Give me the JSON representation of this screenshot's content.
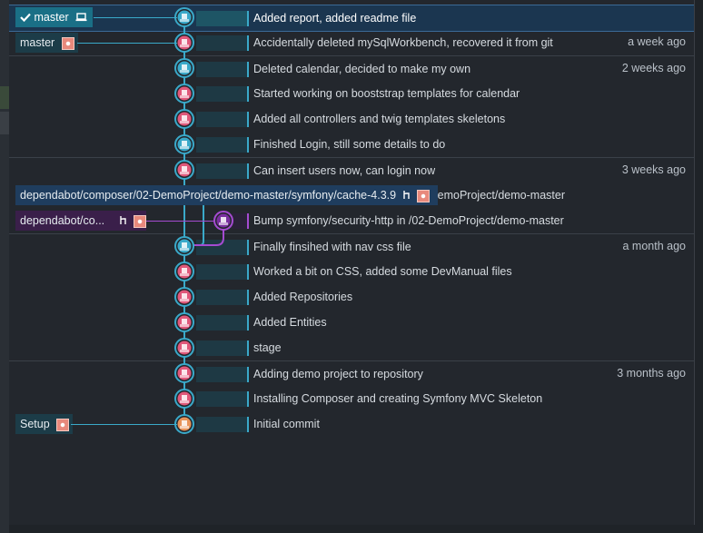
{
  "colors": {
    "teal": "#3aa9c9",
    "purple": "#a54bd1",
    "pink_avatar": "#e8897c",
    "selected": "#1b3650"
  },
  "commits": [
    {
      "message": "Added report, added readme file",
      "time": "",
      "avatar": "teal",
      "selected": true
    },
    {
      "message": "Accidentally deleted mySqlWorkbench, recovered it from git",
      "time": "a week ago",
      "avatar": "pink"
    },
    {
      "message": "Deleted calendar, decided to make my own",
      "time": "2 weeks ago",
      "avatar": "teal"
    },
    {
      "message": "Started working on booststrap templates for calendar",
      "time": "",
      "avatar": "pink"
    },
    {
      "message": "Added all controllers and twig templates skeletons",
      "time": "",
      "avatar": "pink"
    },
    {
      "message": "Finished Login, still some details to do",
      "time": "",
      "avatar": "teal"
    },
    {
      "message": "Can insert users now, can login now",
      "time": "3 weeks ago",
      "avatar": "pink"
    },
    {
      "message": "Bump symfony/cache from 4.3.2 to 4.3.9 in /02-DemoProject/demo-master",
      "time": "",
      "avatar": "none"
    },
    {
      "message": "Bump symfony/security-http in /02-DemoProject/demo-master",
      "time": "",
      "avatar": "dependabot"
    },
    {
      "message": "Finally finsihed with nav css file",
      "time": "a month ago",
      "avatar": "teal"
    },
    {
      "message": "Worked a bit on CSS, added some DevManual files",
      "time": "",
      "avatar": "pink"
    },
    {
      "message": "Added Repositories",
      "time": "",
      "avatar": "pink"
    },
    {
      "message": "Added Entities",
      "time": "",
      "avatar": "pink"
    },
    {
      "message": "stage",
      "time": "",
      "avatar": "pink"
    },
    {
      "message": "Adding demo project to repository",
      "time": "3 months ago",
      "avatar": "pink"
    },
    {
      "message": "Installing Composer and creating Symfony MVC Skeleton",
      "time": "",
      "avatar": "pink"
    },
    {
      "message": "Initial commit",
      "time": "",
      "avatar": "orange"
    }
  ],
  "branches": {
    "head": {
      "label": "master",
      "checked_icon": "check-icon",
      "local_icon": "laptop-icon"
    },
    "master_remote": {
      "label": "master",
      "remote_icon": "avatar-icon"
    },
    "cache": {
      "label": "dependabot/composer/02-DemoProject/demo-master/symfony/cache-4.3.9",
      "icon": "branch-icon"
    },
    "security": {
      "label": "dependabot/co...",
      "icon": "branch-icon"
    },
    "setup": {
      "label": "Setup",
      "remote_icon": "avatar-icon"
    }
  }
}
